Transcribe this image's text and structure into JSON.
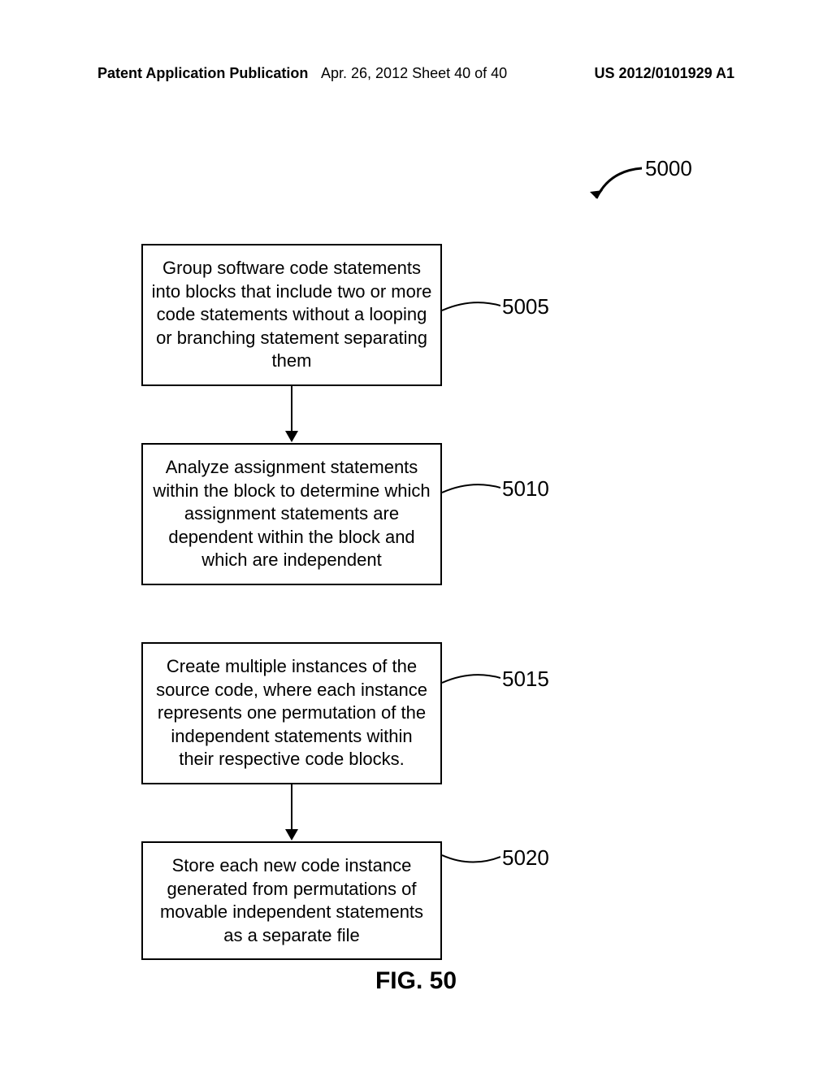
{
  "header": {
    "left": "Patent Application Publication",
    "mid": "Apr. 26, 2012  Sheet 40 of 40",
    "right": "US 2012/0101929 A1"
  },
  "figure_ref": "5000",
  "boxes": {
    "b1": "Group software code statements into blocks that include two or more code statements without a looping or branching statement separating them",
    "b2": "Analyze assignment statements within the block to determine which assignment statements are dependent within the block and which are independent",
    "b3": "Create multiple instances of the source code, where each instance represents one permutation of the independent statements within their respective code blocks.",
    "b4": "Store each new code instance generated from permutations of movable independent statements as a separate file"
  },
  "refs": {
    "r1": "5005",
    "r2": "5010",
    "r3": "5015",
    "r4": "5020"
  },
  "caption": "FIG. 50"
}
